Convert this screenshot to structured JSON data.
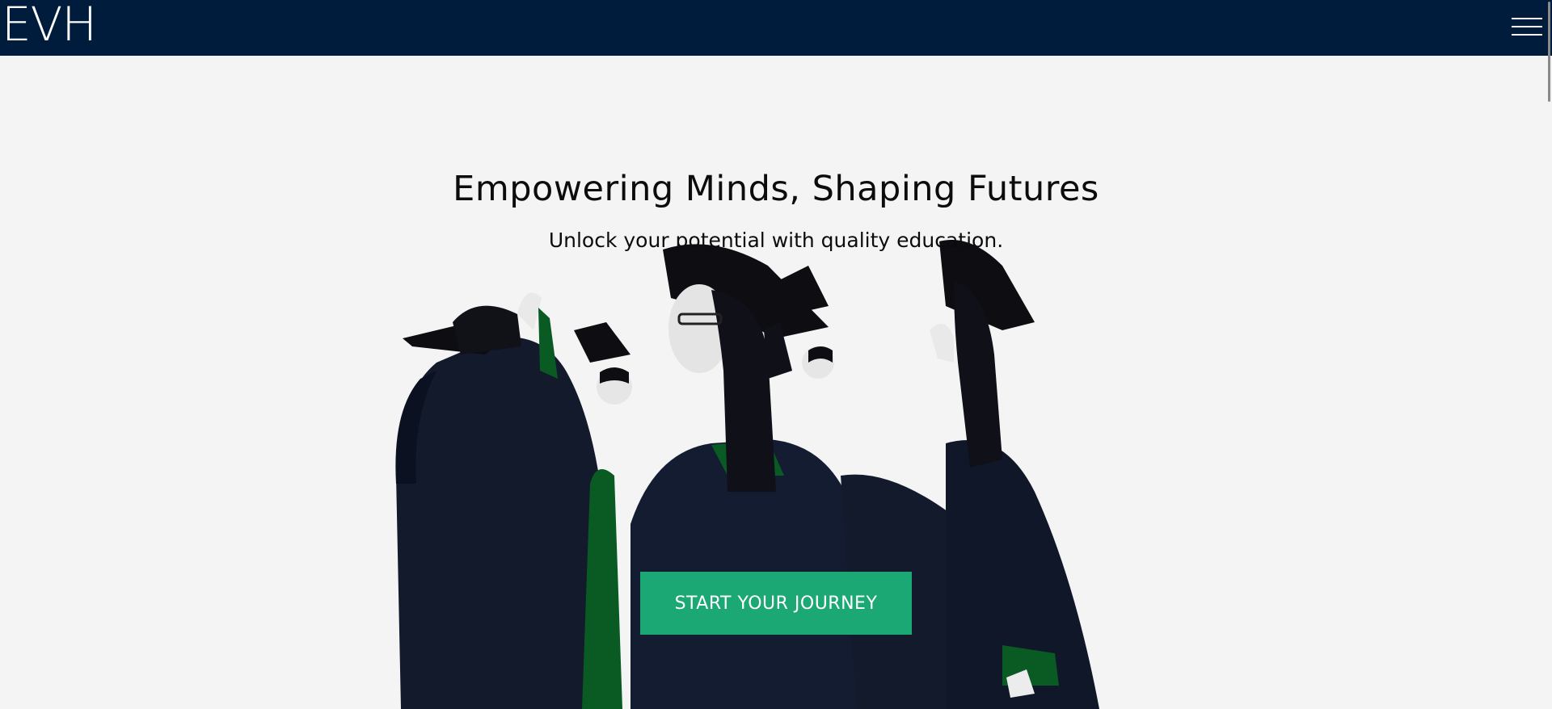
{
  "header": {
    "logo": "EVH",
    "menu_icon": "hamburger-menu-icon"
  },
  "hero": {
    "headline": "Empowering Minds, Shaping Futures",
    "subheadline": "Unlock your potential with quality education.",
    "cta_label": "START YOUR JOURNEY",
    "image_subject": "graduates-in-gowns-image"
  },
  "colors": {
    "nav_background": "#001c3c",
    "page_background": "#f4f4f4",
    "cta_background": "#1ba874",
    "gown_dark": "#121a2c",
    "gown_accent": "#0a5a24"
  }
}
